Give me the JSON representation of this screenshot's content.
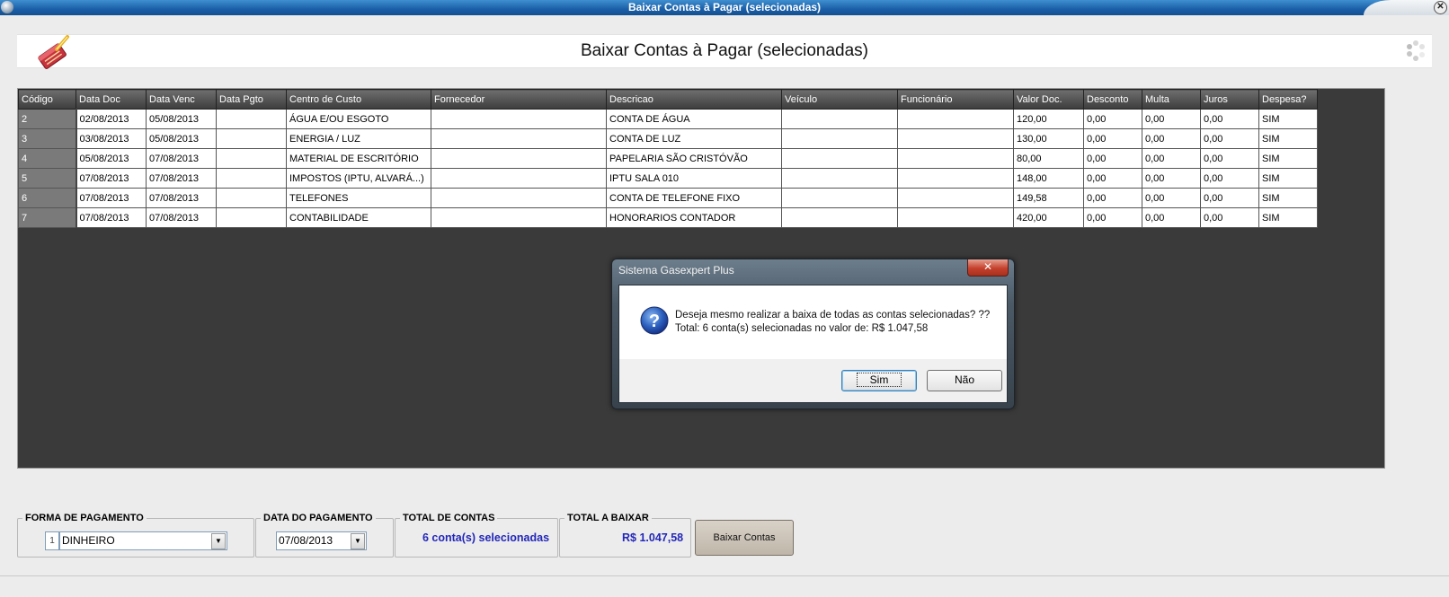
{
  "window": {
    "title": "Baixar Contas à Pagar (selecionadas)",
    "close_glyph": "✕"
  },
  "header": {
    "title": "Baixar Contas à Pagar (selecionadas)",
    "logo_icon": "eraser-broom-icon"
  },
  "grid": {
    "columns": [
      "Código",
      "Data Doc",
      "Data Venc",
      "Data Pgto",
      "Centro de Custo",
      "Fornecedor",
      "Descricao",
      "Veículo",
      "Funcionário",
      "Valor Doc.",
      "Desconto",
      "Multa",
      "Juros",
      "Despesa?"
    ],
    "rows": [
      [
        "2",
        "02/08/2013",
        "05/08/2013",
        "",
        "ÁGUA E/OU ESGOTO",
        "",
        "CONTA DE ÁGUA",
        "",
        "",
        "120,00",
        "0,00",
        "0,00",
        "0,00",
        "SIM"
      ],
      [
        "3",
        "03/08/2013",
        "05/08/2013",
        "",
        "ENERGIA / LUZ",
        "",
        "CONTA DE LUZ",
        "",
        "",
        "130,00",
        "0,00",
        "0,00",
        "0,00",
        "SIM"
      ],
      [
        "4",
        "05/08/2013",
        "07/08/2013",
        "",
        "MATERIAL DE ESCRITÓRIO",
        "",
        "PAPELARIA SÃO CRISTÓVÃO",
        "",
        "",
        "80,00",
        "0,00",
        "0,00",
        "0,00",
        "SIM"
      ],
      [
        "5",
        "07/08/2013",
        "07/08/2013",
        "",
        "IMPOSTOS (IPTU, ALVARÁ...)",
        "",
        "IPTU SALA 010",
        "",
        "",
        "148,00",
        "0,00",
        "0,00",
        "0,00",
        "SIM"
      ],
      [
        "6",
        "07/08/2013",
        "07/08/2013",
        "",
        "TELEFONES",
        "",
        "CONTA DE TELEFONE FIXO",
        "",
        "",
        "149,58",
        "0,00",
        "0,00",
        "0,00",
        "SIM"
      ],
      [
        "7",
        "07/08/2013",
        "07/08/2013",
        "",
        "CONTABILIDADE",
        "",
        "HONORARIOS CONTADOR",
        "",
        "",
        "420,00",
        "0,00",
        "0,00",
        "0,00",
        "SIM"
      ]
    ]
  },
  "dialog": {
    "title": "Sistema Gasexpert Plus",
    "close_glyph": "✕",
    "icon": "question-icon",
    "message_line1": "Deseja mesmo realizar a baixa de todas as contas selecionadas? ??",
    "message_line2": "Total: 6 conta(s) selecionadas no valor de: R$ 1.047,58",
    "yes_label": "Sim",
    "no_label": "Não"
  },
  "payment_form": {
    "legend": "FORMA DE PAGAMENTO",
    "code": "1",
    "value": "DINHEIRO"
  },
  "payment_date": {
    "legend": "DATA DO PAGAMENTO",
    "value": "07/08/2013"
  },
  "total_accounts": {
    "legend": "TOTAL DE CONTAS",
    "value": "6 conta(s) selecionadas"
  },
  "total_amount": {
    "legend": "TOTAL A BAIXAR",
    "value": "R$ 1.047,58"
  },
  "actions": {
    "baixar_label": "Baixar Contas"
  },
  "colors": {
    "grid_bg": "#3a3a3a",
    "title_blue": "#1a5fa8",
    "total_blue": "#2327b9"
  }
}
